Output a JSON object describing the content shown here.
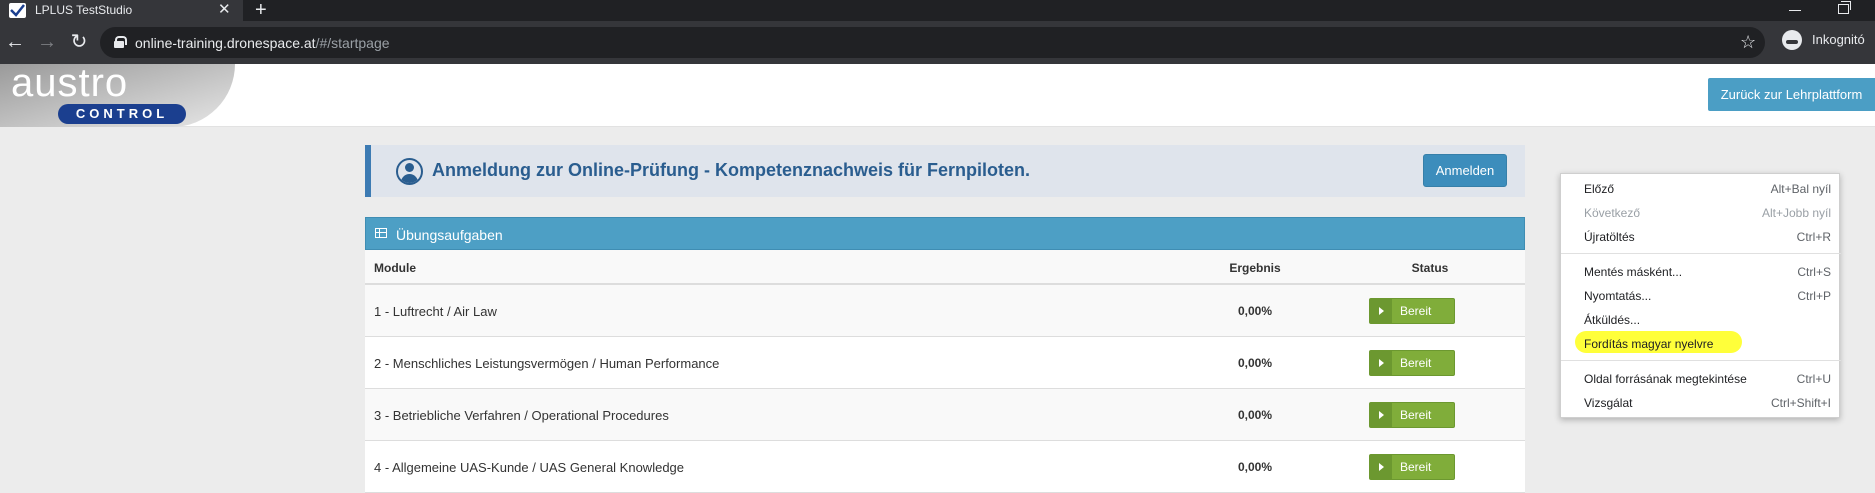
{
  "browser": {
    "tab_title": "LPLUS TestStudio",
    "tab_close": "✕",
    "new_tab": "+",
    "back": "←",
    "forward": "→",
    "reload": "↻",
    "url_host": "online-training.dronespace.at",
    "url_path": "/#/startpage",
    "bookmark_star": "☆",
    "incognito_label": "Inkognitó"
  },
  "header": {
    "logo_word": "austro",
    "logo_badge": "CONTROL",
    "back_button": "Zurück zur Lehrplattform"
  },
  "registration": {
    "title": "Anmeldung zur Online-Prüfung - Kompetenznachweis für Fernpiloten.",
    "button": "Anmelden"
  },
  "exercises": {
    "title": "Übungsaufgaben",
    "columns": {
      "module": "Module",
      "result": "Ergebnis",
      "status": "Status"
    },
    "rows": [
      {
        "module": "1 - Luftrecht / Air Law",
        "result": "0,00%",
        "status": "Bereit"
      },
      {
        "module": "2 - Menschliches Leistungsvermögen / Human Performance",
        "result": "0,00%",
        "status": "Bereit"
      },
      {
        "module": "3 - Betriebliche Verfahren / Operational Procedures",
        "result": "0,00%",
        "status": "Bereit"
      },
      {
        "module": "4 - Allgemeine UAS-Kunde / UAS General Knowledge",
        "result": "0,00%",
        "status": "Bereit"
      }
    ]
  },
  "context_menu": {
    "items": [
      {
        "label": "Előző",
        "shortcut": "Alt+Bal nyíl"
      },
      {
        "label": "Következő",
        "shortcut": "Alt+Jobb nyíl",
        "disabled": true
      },
      {
        "label": "Újratöltés",
        "shortcut": "Ctrl+R"
      },
      {
        "label": "Mentés másként...",
        "shortcut": "Ctrl+S"
      },
      {
        "label": "Nyomtatás...",
        "shortcut": "Ctrl+P"
      },
      {
        "label": "Átküldés...",
        "shortcut": ""
      },
      {
        "label": "Fordítás magyar nyelvre",
        "shortcut": "",
        "highlighted": true
      },
      {
        "label": "Oldal forrásának megtekintése",
        "shortcut": "Ctrl+U"
      },
      {
        "label": "Vizsgálat",
        "shortcut": "Ctrl+Shift+I"
      }
    ],
    "highlight_color": "#ffff3a"
  },
  "colors": {
    "accent_blue": "#4d9fc5",
    "title_blue": "#2a5d8f",
    "status_green": "#80ad3a"
  }
}
